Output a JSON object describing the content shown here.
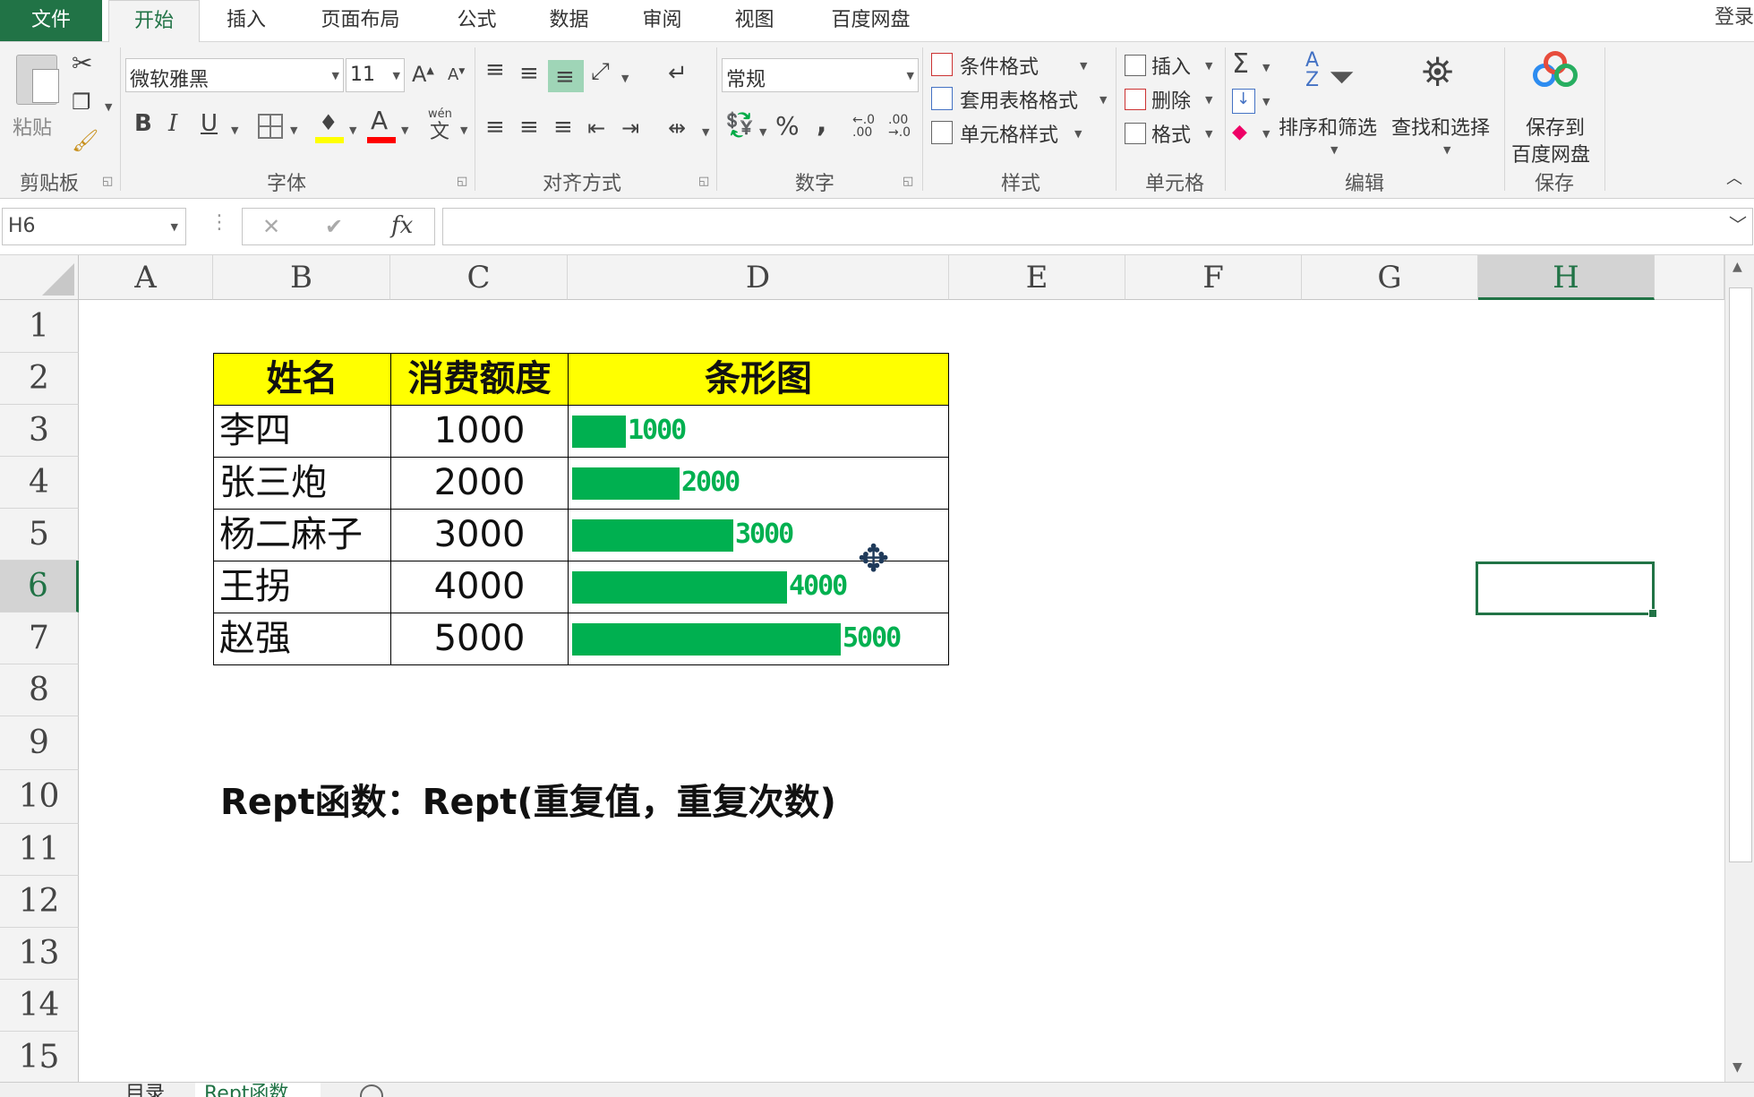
{
  "tabs": {
    "file": "文件",
    "items": [
      "开始",
      "插入",
      "页面布局",
      "公式",
      "数据",
      "审阅",
      "视图",
      "百度网盘"
    ],
    "active": "开始",
    "login": "登录"
  },
  "ribbon": {
    "clipboard": {
      "paste": "粘贴",
      "label": "剪贴板"
    },
    "font": {
      "name": "微软雅黑",
      "size": "11",
      "grow": "A",
      "shrink": "A",
      "bold": "B",
      "italic": "I",
      "underline": "U",
      "font_color_letter": "A",
      "phonetic_top": "wén",
      "phonetic_bottom": "文",
      "label": "字体",
      "highlight_color": "#ffff00",
      "font_color": "#ff0000"
    },
    "alignment": {
      "label": "对齐方式"
    },
    "number": {
      "format": "常规",
      "percent": "%",
      "comma": ",",
      "label": "数字"
    },
    "styles": {
      "conditional": "条件格式",
      "table_format": "套用表格格式",
      "cell_style": "单元格样式",
      "label": "样式"
    },
    "cells": {
      "insert": "插入",
      "delete": "删除",
      "format": "格式",
      "label": "单元格"
    },
    "editing": {
      "sigma": "Σ",
      "sort_filter": "排序和筛选",
      "find_select": "查找和选择",
      "label": "编辑"
    },
    "save": {
      "line1": "保存到",
      "line2": "百度网盘",
      "label": "保存"
    }
  },
  "formula_bar": {
    "name_box": "H6",
    "cancel": "✕",
    "enter": "✔",
    "fx": "fx",
    "content": ""
  },
  "grid": {
    "columns": [
      "A",
      "B",
      "C",
      "D",
      "E",
      "F",
      "G",
      "H"
    ],
    "rows": [
      "1",
      "2",
      "3",
      "4",
      "5",
      "6",
      "7",
      "8",
      "9",
      "10",
      "11",
      "12",
      "13",
      "14",
      "15"
    ],
    "selected_cell": "H6"
  },
  "table": {
    "headers": [
      "姓名",
      "消费额度",
      "条形图"
    ],
    "header_bg": "#ffff00",
    "bar_color": "#00b050",
    "rows": [
      {
        "name": "李四",
        "amount": "1000",
        "bar_label": "1000",
        "bar_fraction": 0.2
      },
      {
        "name": "张三炮",
        "amount": "2000",
        "bar_label": "2000",
        "bar_fraction": 0.4
      },
      {
        "name": "杨二麻子",
        "amount": "3000",
        "bar_label": "3000",
        "bar_fraction": 0.6
      },
      {
        "name": "王拐",
        "amount": "4000",
        "bar_label": "4000",
        "bar_fraction": 0.8
      },
      {
        "name": "赵强",
        "amount": "5000",
        "bar_label": "5000",
        "bar_fraction": 1.0
      }
    ]
  },
  "note": "Rept函数：Rept(重复值，重复次数)",
  "sheets": [
    "目录",
    "Rept函数"
  ]
}
